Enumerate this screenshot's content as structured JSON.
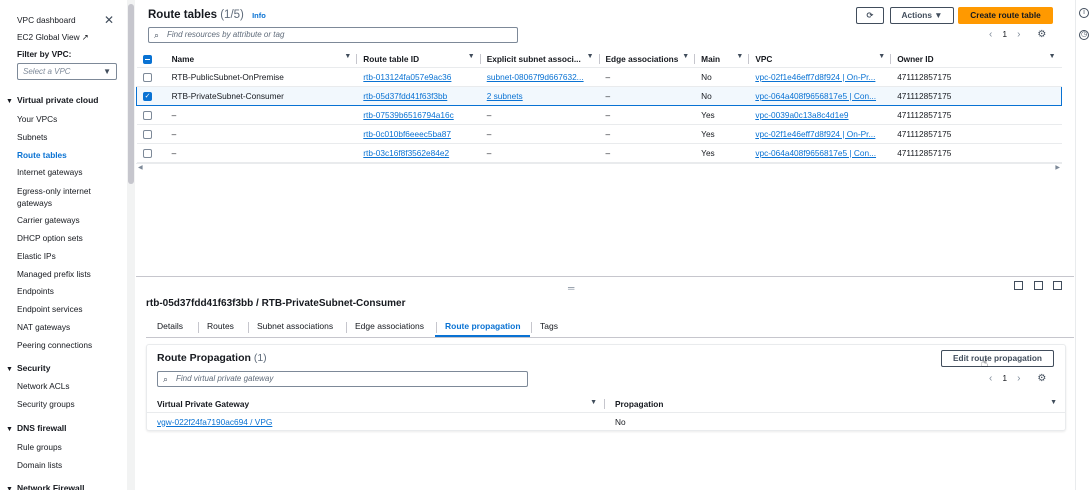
{
  "sidebar": {
    "items_top": [
      "VPC dashboard",
      "EC2 Global View"
    ],
    "filter_label": "Filter by VPC:",
    "vpc_select_placeholder": "Select a VPC",
    "sections": [
      {
        "title": "Virtual private cloud",
        "items": [
          "Your VPCs",
          "Subnets",
          "Route tables",
          "Internet gateways",
          "Egress-only internet gateways",
          "Carrier gateways",
          "DHCP option sets",
          "Elastic IPs",
          "Managed prefix lists",
          "Endpoints",
          "Endpoint services",
          "NAT gateways",
          "Peering connections"
        ]
      },
      {
        "title": "Security",
        "items": [
          "Network ACLs",
          "Security groups"
        ]
      },
      {
        "title": "DNS firewall",
        "items": [
          "Rule groups",
          "Domain lists"
        ]
      },
      {
        "title": "Network Firewall",
        "items": []
      }
    ],
    "active_item": "Route tables"
  },
  "route_tables": {
    "title": "Route tables",
    "count": "(1/5)",
    "info": "Info",
    "actions_label": "Actions",
    "create_label": "Create route table",
    "search_placeholder": "Find resources by attribute or tag",
    "page": "1",
    "columns": [
      "Name",
      "Route table ID",
      "Explicit subnet associ...",
      "Edge associations",
      "Main",
      "VPC",
      "Owner ID"
    ],
    "rows": [
      {
        "name": "RTB-PublicSubnet-OnPremise",
        "id": "rtb-013124fa057e9ac36",
        "subnet": "subnet-08067f9d667632...",
        "edge": "–",
        "main": "No",
        "vpc": "vpc-02f1e46eff7d8f924 | On-Pr...",
        "owner": "471112857175",
        "selected": false
      },
      {
        "name": "RTB-PrivateSubnet-Consumer",
        "id": "rtb-05d37fdd41f63f3bb",
        "subnet": "2 subnets",
        "edge": "–",
        "main": "No",
        "vpc": "vpc-064a408f9656817e5 | Con...",
        "owner": "471112857175",
        "selected": true
      },
      {
        "name": "–",
        "id": "rtb-07539b6516794a16c",
        "subnet": "–",
        "edge": "–",
        "main": "Yes",
        "vpc": "vpc-0039a0c13a8c4d1e9",
        "owner": "471112857175",
        "selected": false
      },
      {
        "name": "–",
        "id": "rtb-0c010bf6eeec5ba87",
        "subnet": "–",
        "edge": "–",
        "main": "Yes",
        "vpc": "vpc-02f1e46eff7d8f924 | On-Pr...",
        "owner": "471112857175",
        "selected": false
      },
      {
        "name": "–",
        "id": "rtb-03c16f8f3562e84e2",
        "subnet": "–",
        "edge": "–",
        "main": "Yes",
        "vpc": "vpc-064a408f9656817e5 | Con...",
        "owner": "471112857175",
        "selected": false
      }
    ]
  },
  "detail": {
    "title": "rtb-05d37fdd41f63f3bb / RTB-PrivateSubnet-Consumer",
    "tabs": [
      "Details",
      "Routes",
      "Subnet associations",
      "Edge associations",
      "Route propagation",
      "Tags"
    ],
    "active_tab": "Route propagation",
    "propagation": {
      "title": "Route Propagation",
      "count": "(1)",
      "edit_label": "Edit route propagation",
      "search_placeholder": "Find virtual private gateway",
      "page": "1",
      "columns": [
        "Virtual Private Gateway",
        "Propagation"
      ],
      "rows": [
        {
          "gateway": "vgw-022f24fa7190ac694 / VPG",
          "propagation": "No"
        }
      ]
    }
  },
  "colors": {
    "accent": "#0972d3",
    "primary_button": "#ff9900"
  }
}
